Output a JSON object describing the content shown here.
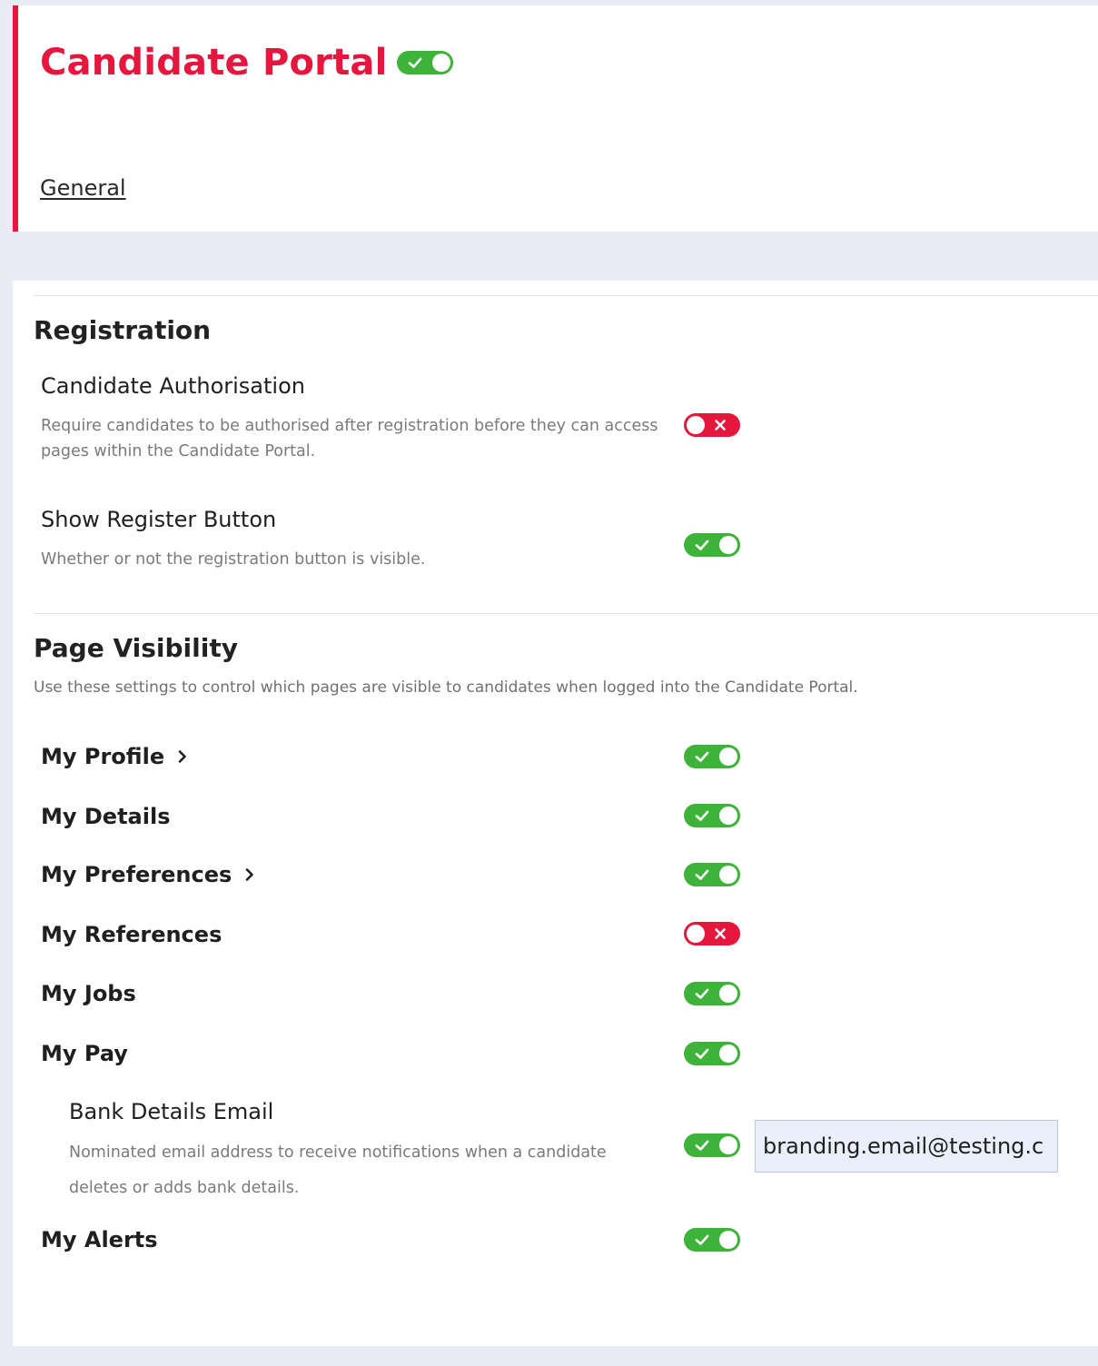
{
  "header": {
    "title": "Candidate Portal",
    "portal_enabled": true,
    "tab_general": "General"
  },
  "registration": {
    "title": "Registration",
    "candidate_authorisation": {
      "label": "Candidate Authorisation",
      "description": "Require candidates to be authorised after registration before they can access pages within the Candidate Portal.",
      "enabled": false
    },
    "show_register_button": {
      "label": "Show Register Button",
      "description": "Whether or not the registration button is visible.",
      "enabled": true
    }
  },
  "page_visibility": {
    "title": "Page Visibility",
    "description": "Use these settings to control which pages are visible to candidates when logged into the Candidate Portal.",
    "pages": [
      {
        "label": "My Profile",
        "enabled": true,
        "has_chevron": true
      },
      {
        "label": "My Details",
        "enabled": true,
        "has_chevron": false
      },
      {
        "label": "My Preferences",
        "enabled": true,
        "has_chevron": true
      },
      {
        "label": "My References",
        "enabled": false,
        "has_chevron": false
      },
      {
        "label": "My Jobs",
        "enabled": true,
        "has_chevron": false
      },
      {
        "label": "My Pay",
        "enabled": true,
        "has_chevron": false
      }
    ],
    "bank_details_email": {
      "label": "Bank Details Email",
      "description": "Nominated email address to receive notifications when a candidate deletes or adds bank details.",
      "enabled": true,
      "value": "branding.email@testing.c"
    },
    "my_alerts": {
      "label": "My Alerts",
      "enabled": true
    }
  },
  "colors": {
    "accent": "#e5173f",
    "toggle_on": "#3eb33a",
    "toggle_off": "#e5173f"
  }
}
